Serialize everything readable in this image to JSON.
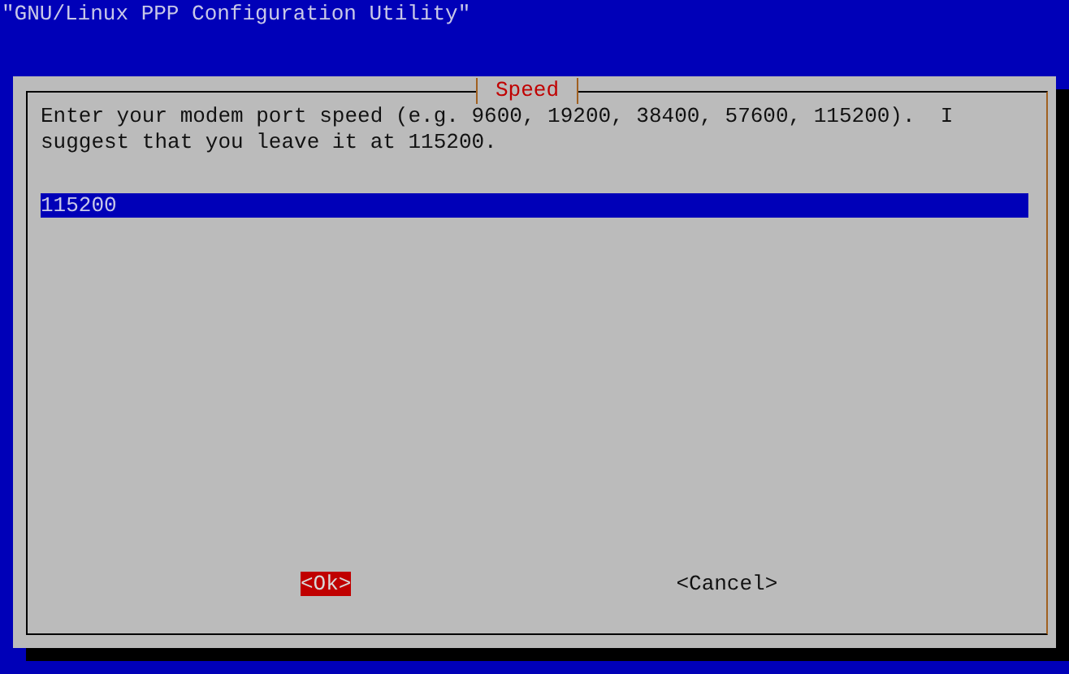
{
  "screen_title": "\"GNU/Linux PPP Configuration Utility\"",
  "dialog": {
    "title": "Speed",
    "message": "Enter your modem port speed (e.g. 9600, 19200, 38400, 57600, 115200).  I suggest that you leave it at 115200.",
    "input": {
      "value": "115200"
    },
    "buttons": [
      {
        "label": "<Ok>",
        "selected": true
      },
      {
        "label": "<Cancel>",
        "selected": false
      }
    ]
  }
}
